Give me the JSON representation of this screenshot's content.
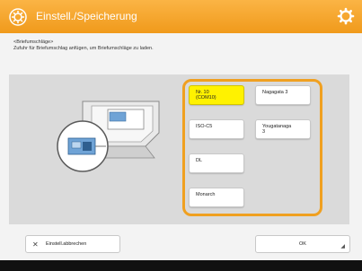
{
  "titlebar": {
    "title": "Einstell./Speicherung",
    "icon": "gear-icon",
    "title_icon": "settings-gear-circle-icon"
  },
  "instruction": {
    "line1": "<Briefumschläge>",
    "line2": "Zufuhr für Briefumschlag anfügen, um Briefumschläge zu laden."
  },
  "options": [
    {
      "label_line1": "Nr. 10",
      "label_line2": "(COM10)",
      "selected": true
    },
    {
      "label_line1": "Nagagata 3",
      "label_line2": "",
      "selected": false
    },
    {
      "label_line1": "ISO-C5",
      "label_line2": "",
      "selected": false
    },
    {
      "label_line1": "Yougatanaga",
      "label_line2": "3",
      "selected": false
    },
    {
      "label_line1": "DL",
      "label_line2": "",
      "selected": false
    },
    {
      "label_line1": "Monarch",
      "label_line2": "",
      "selected": false
    }
  ],
  "footer": {
    "cancel_label": "Einstell.abbrechen",
    "ok_label": "OK"
  },
  "colors": {
    "accent": "#f09a1b",
    "selected": "#fff200",
    "frame": "#f0a020"
  }
}
